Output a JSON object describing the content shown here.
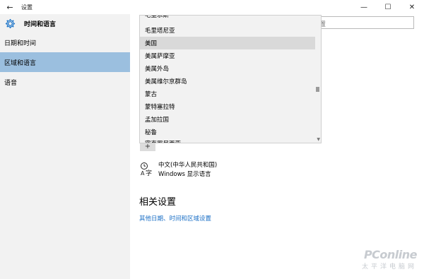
{
  "window": {
    "title": "设置",
    "back_glyph": "←",
    "min_glyph": "—",
    "max_glyph": "☐",
    "close_glyph": "✕"
  },
  "sidebar": {
    "title": "时间和语言",
    "items": [
      {
        "label": "日期和时间"
      },
      {
        "label": "区域和语言"
      },
      {
        "label": "语音"
      }
    ]
  },
  "search": {
    "text": "置"
  },
  "dropdown": {
    "items": [
      {
        "label": "毛里求斯"
      },
      {
        "label": "毛里塔尼亚"
      },
      {
        "label": "美国"
      },
      {
        "label": "美属萨摩亚"
      },
      {
        "label": "美属外岛"
      },
      {
        "label": "美属维尔京群岛"
      },
      {
        "label": "蒙古"
      },
      {
        "label": "蒙特塞拉特"
      },
      {
        "label": "孟加拉国"
      },
      {
        "label": "秘鲁"
      },
      {
        "label": "密克罗尼西亚"
      }
    ],
    "selected_index": 2,
    "scroll_position": 0.58
  },
  "main": {
    "add_glyph": "+",
    "language_name": "中文(中华人民共和国)",
    "language_sub": "Windows 显示语言",
    "related_title": "相关设置",
    "related_link": "其他日期、时间和区域设置"
  },
  "watermark": {
    "logo": "PConline",
    "sub": "太平洋电脑网"
  },
  "colors": {
    "accent": "#1a6fc6",
    "sidebar_active": "#9bbfdf",
    "sidebar_bg": "#f2f2f2"
  }
}
